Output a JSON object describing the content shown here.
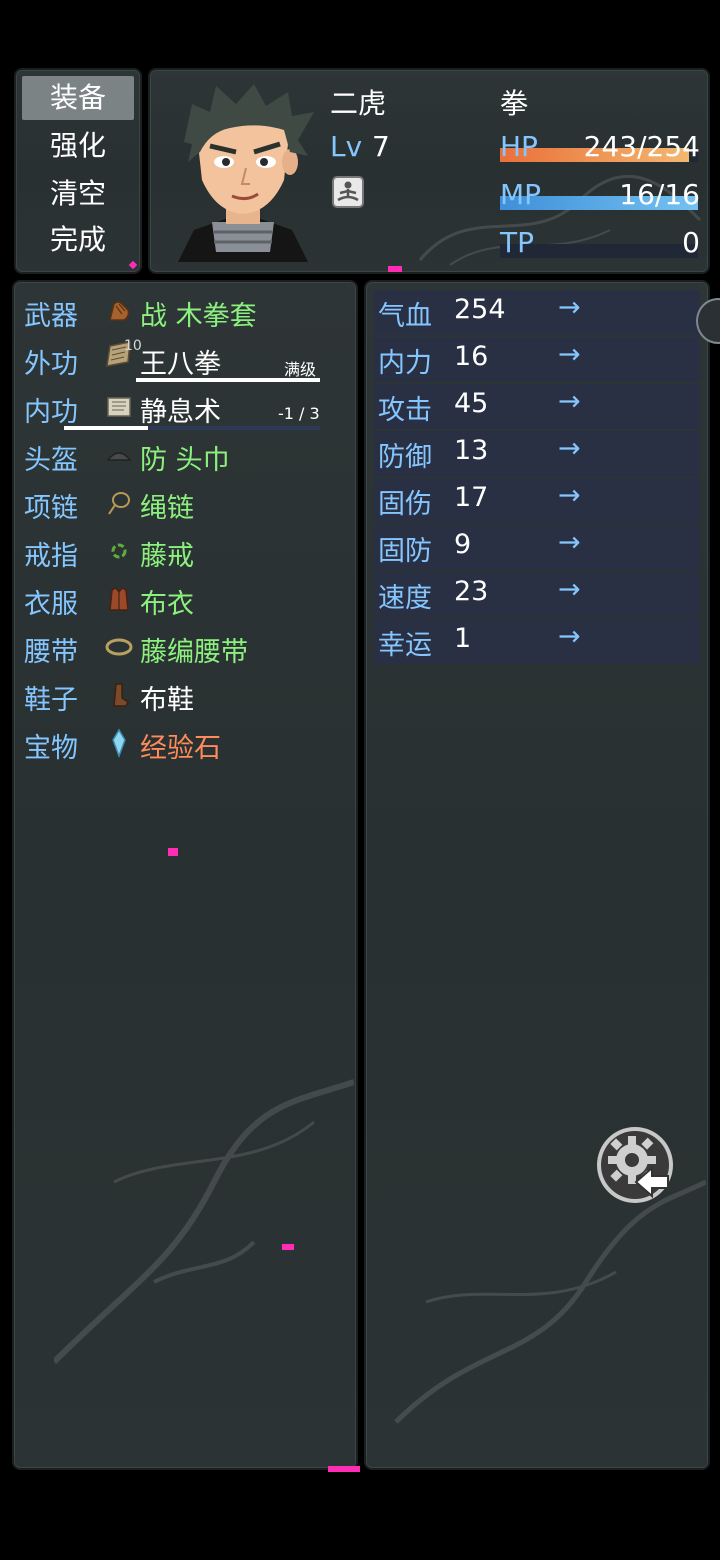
{
  "menu": {
    "items": [
      "装备",
      "强化",
      "清空",
      "完成"
    ],
    "selected": 0
  },
  "actor": {
    "name": "二虎",
    "class_name": "拳",
    "level_label": "Lv",
    "level": "7",
    "state_icon": "meditation-icon",
    "hp": {
      "label": "HP",
      "value": "243/254",
      "ratio": 0.957,
      "color_a": "#e9703a",
      "color_b": "#f3b870"
    },
    "mp": {
      "label": "MP",
      "value": "16/16",
      "ratio": 1.0,
      "color_a": "#3f8fd8",
      "color_b": "#74c2f2"
    },
    "tp": {
      "label": "TP",
      "value": "0",
      "ratio": 0.0
    }
  },
  "equipment": [
    {
      "slot": "武器",
      "item": "战 木拳套",
      "color": "green",
      "icon": "glove-icon"
    },
    {
      "slot": "外功",
      "item": "王八拳",
      "color": "white",
      "icon": "scroll-book-icon",
      "badge": "10",
      "note": "满级",
      "progress": 1.0
    },
    {
      "slot": "内功",
      "item": "静息术",
      "color": "white",
      "icon": "scroll-icon",
      "note": "-1 / 3",
      "progress": 0.33
    },
    {
      "slot": "头盔",
      "item": "防 头巾",
      "color": "green",
      "icon": "headband-icon"
    },
    {
      "slot": "项链",
      "item": "绳链",
      "color": "green",
      "icon": "necklace-icon"
    },
    {
      "slot": "戒指",
      "item": "藤戒",
      "color": "green",
      "icon": "ring-icon"
    },
    {
      "slot": "衣服",
      "item": "布衣",
      "color": "green",
      "icon": "clothes-icon"
    },
    {
      "slot": "腰带",
      "item": "藤编腰带",
      "color": "green",
      "icon": "belt-icon"
    },
    {
      "slot": "鞋子",
      "item": "布鞋",
      "color": "white",
      "icon": "shoe-icon"
    },
    {
      "slot": "宝物",
      "item": "经验石",
      "color": "orange",
      "icon": "crystal-icon"
    }
  ],
  "params": [
    {
      "name": "气血",
      "value": "254",
      "arrow": "→"
    },
    {
      "name": "内力",
      "value": "16",
      "arrow": "→"
    },
    {
      "name": "攻击",
      "value": "45",
      "arrow": "→"
    },
    {
      "name": "防御",
      "value": "13",
      "arrow": "→"
    },
    {
      "name": "固伤",
      "value": "17",
      "arrow": "→"
    },
    {
      "name": "固防",
      "value": "9",
      "arrow": "→"
    },
    {
      "name": "速度",
      "value": "23",
      "arrow": "→"
    },
    {
      "name": "幸运",
      "value": "1",
      "arrow": "→"
    }
  ],
  "settings_button": {
    "icon": "gear-back-icon"
  }
}
